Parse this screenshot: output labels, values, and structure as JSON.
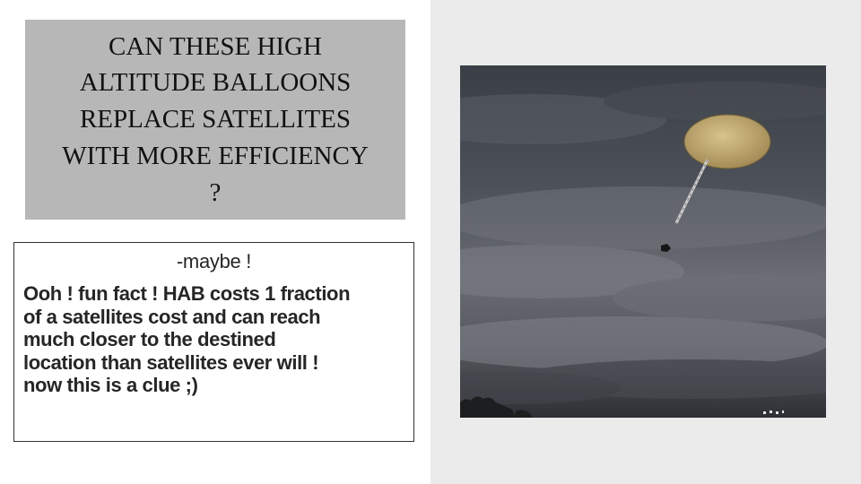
{
  "slide": {
    "title_lines": [
      "CAN THESE HIGH",
      "ALTITUDE BALLOONS",
      "REPLACE SATELLITES",
      "WITH MORE EFFICIENCY",
      "?"
    ],
    "body": {
      "maybe": "-maybe !",
      "fact_lines": [
        "Ooh ! fun fact !  HAB costs 1 fraction",
        "of a satellites cost and can reach",
        "much closer to the destined",
        "location than satellites ever will !",
        "now this is a clue ;)"
      ]
    }
  },
  "colors": {
    "title_box": "#b7b7b7",
    "right_panel": "#ebebeb",
    "sky_dark": "#2f3238",
    "balloon": "#c9b27a"
  }
}
